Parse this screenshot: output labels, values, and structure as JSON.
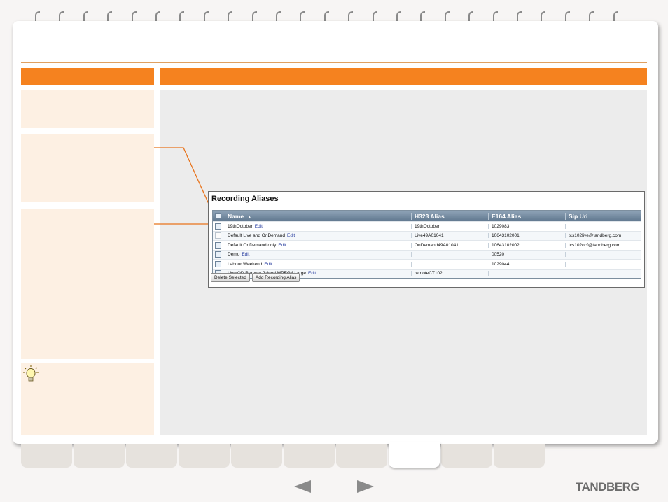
{
  "panel": {
    "title": "Recording Aliases",
    "columns": [
      "Name",
      "H323 Alias",
      "E164 Alias",
      "Sip Uri"
    ],
    "sort_indicator": "▲",
    "rows": [
      {
        "name": "19thOctober",
        "edit": "Edit",
        "h323": "19thOctober",
        "e164": "1029083",
        "sip": "",
        "checkbox_style": "normal"
      },
      {
        "name": "Default Live and OnDemand",
        "edit": "Edit",
        "h323": "Live49A01041",
        "e164": "10643102001",
        "sip": "tcs102live@tandberg.com",
        "checkbox_style": "disabled"
      },
      {
        "name": "Default OnDemand only",
        "edit": "Edit",
        "h323": "OnDemand49A01041",
        "e164": "10643102002",
        "sip": "tcs102ocf@tandberg.com",
        "checkbox_style": "normal"
      },
      {
        "name": "Demo",
        "edit": "Edit",
        "h323": "",
        "e164": "00520",
        "sip": "",
        "checkbox_style": "normal"
      },
      {
        "name": "Labour Weekend",
        "edit": "Edit",
        "h323": "",
        "e164": "1029044",
        "sip": "",
        "checkbox_style": "normal"
      },
      {
        "name": "Live/OD Remote Joined MPEG4 Large",
        "edit": "Edit",
        "h323": "remoteCT102",
        "e164": "",
        "sip": "",
        "checkbox_style": "normal"
      }
    ],
    "buttons": {
      "delete": "Delete Selected",
      "add": "Add Recording Alias"
    }
  },
  "footer": {
    "brand": "TANDBERG",
    "active_tab_index": 7,
    "tab_count": 10
  },
  "colors": {
    "accent": "#f5821f",
    "side_box": "#fdf0e3",
    "content_bg": "#ececec"
  }
}
